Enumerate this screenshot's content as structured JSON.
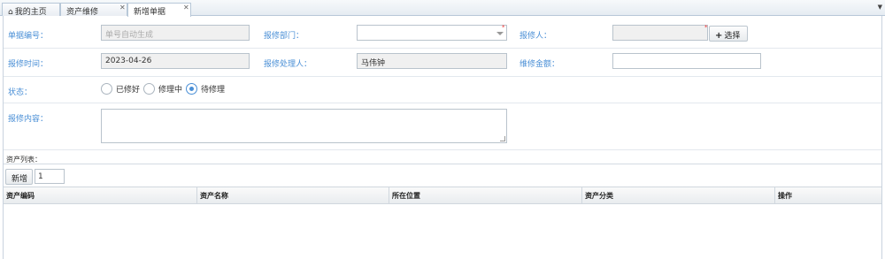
{
  "tabs": [
    {
      "label": "我的主页",
      "has_home_icon": true,
      "closable": false
    },
    {
      "label": "资产维修",
      "closable": true
    },
    {
      "label": "新增单据",
      "closable": true,
      "active": true
    }
  ],
  "form": {
    "doc_no": {
      "label": "单据编号：",
      "placeholder": "单号自动生成"
    },
    "dept": {
      "label": "报修部门：",
      "value": ""
    },
    "reporter": {
      "label": "报修人：",
      "value": "",
      "select_button": "选择"
    },
    "report_time": {
      "label": "报修时间：",
      "value": "2023-04-26"
    },
    "handler": {
      "label": "报修处理人：",
      "value": "马伟钟"
    },
    "amount": {
      "label": "维修金额：",
      "value": ""
    },
    "status": {
      "label": "状态：",
      "options": [
        "已修好",
        "修理中",
        "待修理"
      ],
      "selected": "待修理"
    },
    "content": {
      "label": "报修内容：",
      "value": ""
    }
  },
  "asset_list": {
    "title": "资产列表：",
    "add_button": "新增",
    "add_count": "1",
    "columns": [
      "资产编码",
      "资产名称",
      "所在位置",
      "资产分类",
      "操作"
    ],
    "rows": []
  },
  "colors": {
    "label_blue": "#4a8fd6",
    "required_red": "#e33333"
  }
}
